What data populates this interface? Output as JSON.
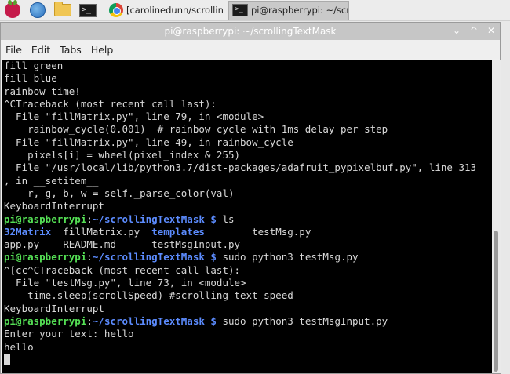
{
  "taskbar": {
    "chrome_task_label": "[carolinedunn/scrollin",
    "terminal_task_label": "pi@raspberrypi: ~/scr",
    "term_glyph": ">_"
  },
  "window": {
    "title": "pi@raspberrypi: ~/scrollingTextMask",
    "menu": [
      "File",
      "Edit",
      "Tabs",
      "Help"
    ],
    "btn_min": "⌄",
    "btn_max": "^",
    "btn_close": "✕"
  },
  "terminal": {
    "lines": [
      {
        "plain": "fill green"
      },
      {
        "plain": "fill blue"
      },
      {
        "plain": "rainbow time!"
      },
      {
        "plain": "^CTraceback (most recent call last):"
      },
      {
        "plain": "  File \"fillMatrix.py\", line 79, in <module>"
      },
      {
        "plain": "    rainbow_cycle(0.001)  # rainbow cycle with 1ms delay per step"
      },
      {
        "plain": "  File \"fillMatrix.py\", line 49, in rainbow_cycle"
      },
      {
        "plain": "    pixels[i] = wheel(pixel_index & 255)"
      },
      {
        "plain": "  File \"/usr/local/lib/python3.7/dist-packages/adafruit_pypixelbuf.py\", line 313"
      },
      {
        "plain": ", in __setitem__"
      },
      {
        "plain": "    r, g, b, w = self._parse_color(val)"
      },
      {
        "plain": "KeyboardInterrupt"
      },
      {
        "user": "pi@raspberrypi",
        "colon": ":",
        "path": "~/scrollingTextMask $",
        "cmd": " ls"
      },
      {
        "dir1": "32Matrix",
        "mid1": "  fillMatrix.py  ",
        "dir2": "templates",
        "mid2": "        testMsg.py"
      },
      {
        "plain": "app.py    README.md      testMsgInput.py"
      },
      {
        "user": "pi@raspberrypi",
        "colon": ":",
        "path": "~/scrollingTextMask $",
        "cmd": " sudo python3 testMsg.py"
      },
      {
        "plain": "^[cc^CTraceback (most recent call last):"
      },
      {
        "plain": "  File \"testMsg.py\", line 73, in <module>"
      },
      {
        "plain": "    time.sleep(scrollSpeed) #scrolling text speed"
      },
      {
        "plain": "KeyboardInterrupt"
      },
      {
        "user": "pi@raspberrypi",
        "colon": ":",
        "path": "~/scrollingTextMask $",
        "cmd": " sudo python3 testMsgInput.py"
      },
      {
        "plain": "Enter your text: hello"
      },
      {
        "plain": "hello"
      }
    ]
  },
  "colors": {
    "prompt_green": "#55e055",
    "prompt_blue": "#5c8cff",
    "terminal_bg": "#000000"
  }
}
